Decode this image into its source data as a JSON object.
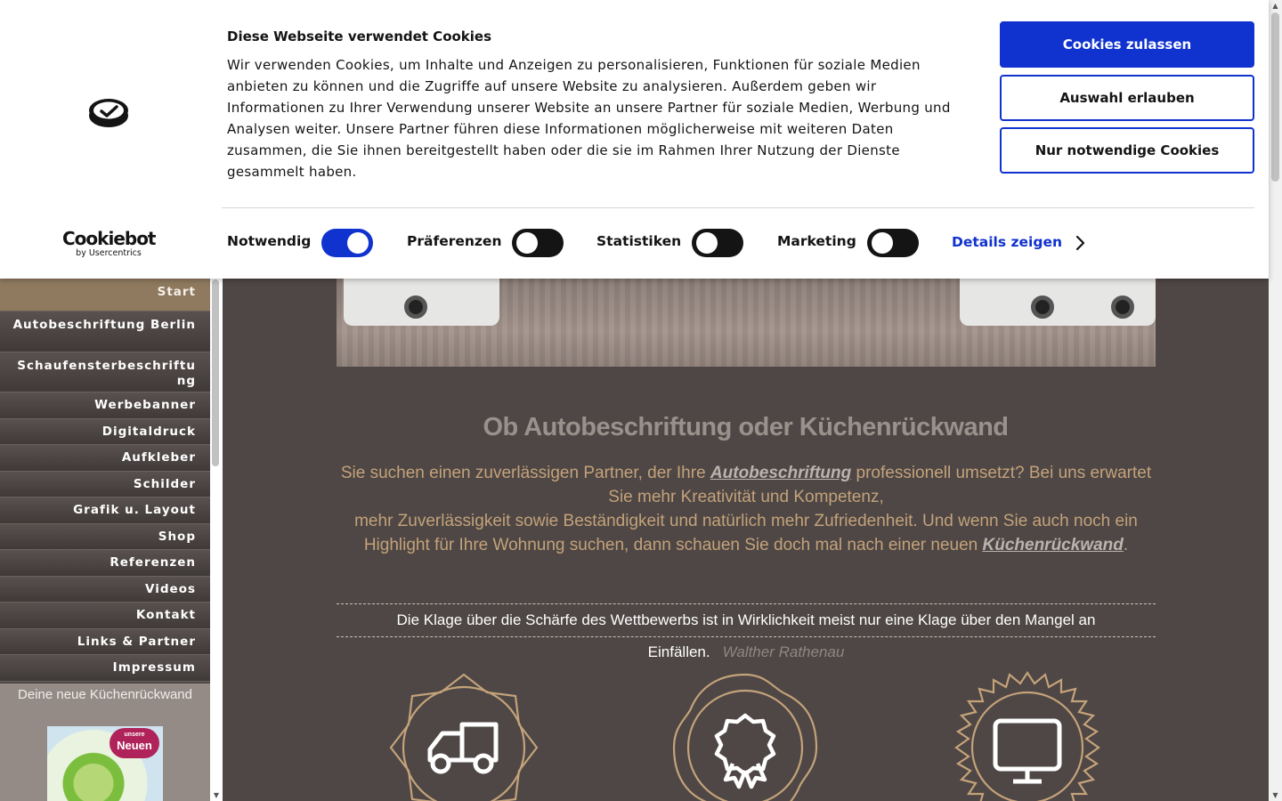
{
  "cookie_banner": {
    "brand_name": "Cookiebot",
    "brand_sub": "by Usercentrics",
    "title": "Diese Webseite verwendet Cookies",
    "body": "Wir verwenden Cookies, um Inhalte und Anzeigen zu personalisieren, Funktionen für soziale Medien anbieten zu können und die Zugriffe auf unsere Website zu analysieren. Außerdem geben wir Informationen zu Ihrer Verwendung unserer Website an unsere Partner für soziale Medien, Werbung und Analysen weiter. Unsere Partner führen diese Informationen möglicherweise mit weiteren Daten zusammen, die Sie ihnen bereitgestellt haben oder die sie im Rahmen Ihrer Nutzung der Dienste gesammelt haben.",
    "buttons": {
      "allow_all": "Cookies zulassen",
      "allow_selection": "Auswahl erlauben",
      "necessary_only": "Nur notwendige Cookies"
    },
    "toggles": [
      {
        "label": "Notwendig",
        "on": true
      },
      {
        "label": "Präferenzen",
        "on": false
      },
      {
        "label": "Statistiken",
        "on": false
      },
      {
        "label": "Marketing",
        "on": false
      }
    ],
    "details_link": "Details zeigen",
    "colors": {
      "accent": "#1032cf",
      "text": "#141414"
    }
  },
  "sidebar": {
    "items": [
      {
        "label": "Start",
        "active": true
      },
      {
        "label": "Autobeschriftung Berlin"
      },
      {
        "label": "Schaufensterbeschriftung"
      },
      {
        "label": "Werbebanner"
      },
      {
        "label": "Digitaldruck"
      },
      {
        "label": "Aufkleber"
      },
      {
        "label": "Schilder"
      },
      {
        "label": "Grafik u. Layout"
      },
      {
        "label": "Shop"
      },
      {
        "label": "Referenzen"
      },
      {
        "label": "Videos"
      },
      {
        "label": "Kontakt"
      },
      {
        "label": "Links & Partner"
      },
      {
        "label": "Impressum"
      }
    ],
    "teaser_title": "Deine neue Küchenrückwand",
    "teaser_badge_small": "unsere",
    "teaser_badge": "Neuen"
  },
  "main": {
    "headline": "Ob Autobeschriftung oder Küchenrückwand",
    "intro": {
      "part1": "Sie suchen einen zuverlässigen Partner, der Ihre ",
      "link1": "Autobeschriftung",
      "part2": " professionell umsetzt? Bei uns erwartet Sie mehr Kreativität und Kompetenz,",
      "part3": "mehr Zuverlässigkeit sowie Beständigkeit und natürlich mehr Zufriedenheit. Und wenn Sie auch noch ein Highlight für Ihre Wohnung suchen, dann schauen Sie doch mal nach einer neuen ",
      "link2": "Küchenrückwand",
      "part4": "."
    },
    "quote": {
      "text": "Die Klage über die Schärfe des Wettbewerbs ist in Wirklichkeit meist nur eine Klage über den Mangel an Einfällen.",
      "author": "Walther Rathenau"
    },
    "features": [
      {
        "icon": "truck-icon"
      },
      {
        "icon": "award-icon"
      },
      {
        "icon": "monitor-icon"
      }
    ],
    "colors": {
      "background": "#4e4745",
      "gold": "#c4a27a"
    }
  }
}
